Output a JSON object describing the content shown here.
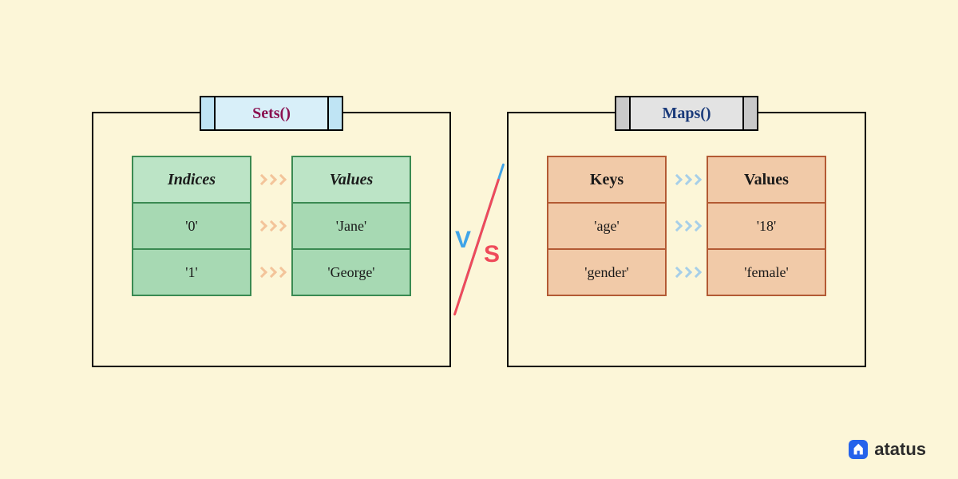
{
  "left": {
    "title": "Sets()",
    "col1_header": "Indices",
    "col2_header": "Values",
    "rows": [
      {
        "k": "'0'",
        "v": "'Jane'"
      },
      {
        "k": "'1'",
        "v": "'George'"
      }
    ]
  },
  "right": {
    "title": "Maps()",
    "col1_header": "Keys",
    "col2_header": "Values",
    "rows": [
      {
        "k": "'age'",
        "v": "'18'"
      },
      {
        "k": "'gender'",
        "v": "'female'"
      }
    ]
  },
  "versus": {
    "v": "V",
    "s": "S"
  },
  "brand": {
    "name": "atatus"
  },
  "colors": {
    "background": "#fcf6d8",
    "sets_cell": "#a7d9b3",
    "sets_border": "#3a8a52",
    "maps_cell": "#f1caa8",
    "maps_border": "#b35a34",
    "vs_blue": "#3fa4e8",
    "vs_red": "#ef4a5a",
    "brand_blue": "#2563eb"
  }
}
